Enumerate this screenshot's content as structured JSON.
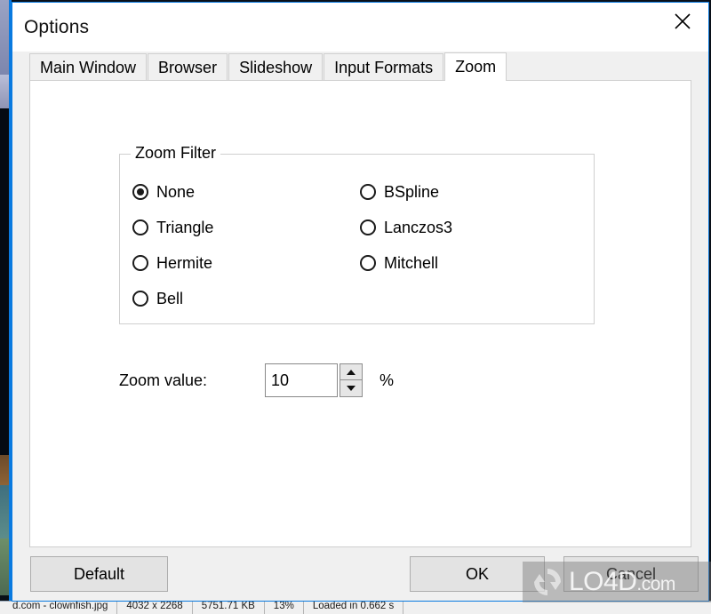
{
  "window": {
    "title": "Options",
    "close_icon": "close-x-icon",
    "border_color": "#0a7ae0"
  },
  "tabs": [
    {
      "label": "Main Window",
      "active": false
    },
    {
      "label": "Browser",
      "active": false
    },
    {
      "label": "Slideshow",
      "active": false
    },
    {
      "label": "Input Formats",
      "active": false
    },
    {
      "label": "Zoom",
      "active": true
    }
  ],
  "zoom_filter": {
    "legend": "Zoom Filter",
    "left_options": [
      {
        "label": "None",
        "checked": true
      },
      {
        "label": "Triangle",
        "checked": false
      },
      {
        "label": "Hermite",
        "checked": false
      },
      {
        "label": "Bell",
        "checked": false
      }
    ],
    "right_options": [
      {
        "label": "BSpline",
        "checked": false
      },
      {
        "label": "Lanczos3",
        "checked": false
      },
      {
        "label": "Mitchell",
        "checked": false
      }
    ]
  },
  "zoom_value": {
    "label": "Zoom value:",
    "value": "10",
    "placeholder": "",
    "suffix": "%",
    "spinner_up_icon": "triangle-up-icon",
    "spinner_down_icon": "triangle-down-icon"
  },
  "footer": {
    "default_label": "Default",
    "ok_label": "OK",
    "cancel_label": "Cancel"
  },
  "watermark": {
    "text": "LO4D",
    "suffix": ".com",
    "logo_icon": "circular-arrows-icon"
  },
  "parent_statusbar": {
    "cells": [
      "d.com - clownfish.jpg",
      "4032 x 2268",
      "5751.71 KB",
      "13%",
      "Loaded in 0.662 s"
    ]
  }
}
